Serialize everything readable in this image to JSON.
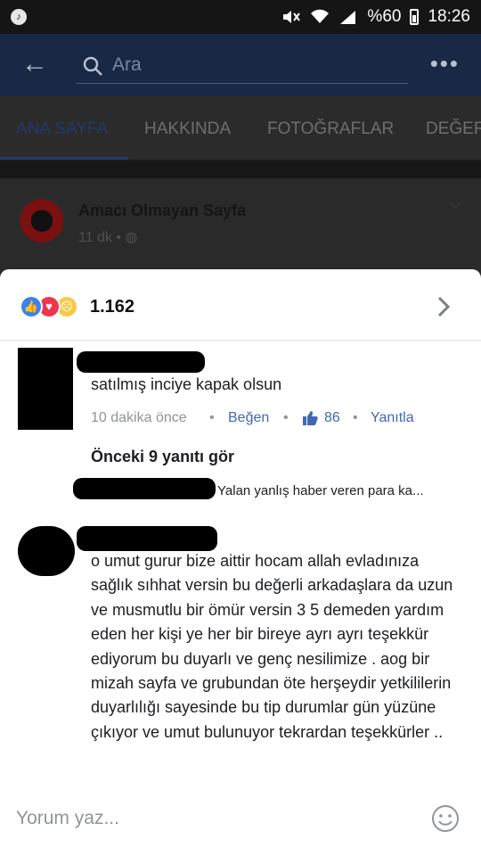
{
  "status_bar": {
    "battery": "%60",
    "time": "18:26"
  },
  "header": {
    "search_placeholder": "Ara"
  },
  "tabs": [
    {
      "label": "ANA SAYFA",
      "active": true
    },
    {
      "label": "HAKKINDA"
    },
    {
      "label": "FOTOĞRAFLAR"
    },
    {
      "label": "DEĞER"
    }
  ],
  "post": {
    "page_name": "Amacı Olmayan Sayfa",
    "time": "11 dk"
  },
  "reactions": {
    "count": "1.162",
    "icons": [
      "like-icon",
      "love-icon",
      "sad-icon"
    ]
  },
  "comment1": {
    "text": "satılmış inciye kapak olsun",
    "time": "10 dakika önce",
    "like_label": "Beğen",
    "like_count": "86",
    "reply_label": "Yanıtla",
    "separator": "•"
  },
  "previous_replies_label": "Önceki 9 yanıtı gör",
  "reply_preview": "Yalan yanlış haber veren para ka...",
  "comment2": {
    "text": "o umut gurur bize aittir hocam allah evladınıza sağlık sıhhat versin bu değerli arkadaşlara da uzun ve musmutlu bir ömür versin 3 5 demeden yardım eden her kişi ye her bir bireye ayrı ayrı teşekkür ediyorum bu duyarlı ve genç nesilimize . aog bir mizah sayfa ve grubundan öte herşeydir yetkililerin duyarlılığı sayesinde bu tip durumlar gün yüzüne çıkıyor ve umut bulunuyor tekrardan teşekkürler .."
  },
  "composer": {
    "placeholder": "Yorum yaz..."
  },
  "colors": {
    "header_bg": "#182845",
    "link": "#4267b2",
    "like_blue": "#3b82f0",
    "love_red": "#f0344e",
    "sad_yellow": "#f7c948"
  }
}
